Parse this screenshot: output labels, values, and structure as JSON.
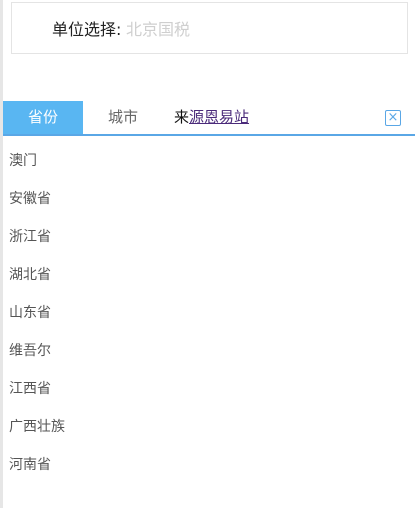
{
  "unit_select": {
    "label": "单位选择:",
    "value": "北京国税"
  },
  "tabs": {
    "province": "省份",
    "city": "城市",
    "source_prefix": "来",
    "source_link": "源恩易站"
  },
  "close": {
    "symbol": "×"
  },
  "provinces": [
    "澳门",
    "安徽省",
    "浙江省",
    "湖北省",
    "山东省",
    "维吾尔",
    "江西省",
    "广西壮族",
    "河南省"
  ],
  "colors": {
    "accent": "#59b6f2",
    "underline": "#5aa7e6"
  }
}
